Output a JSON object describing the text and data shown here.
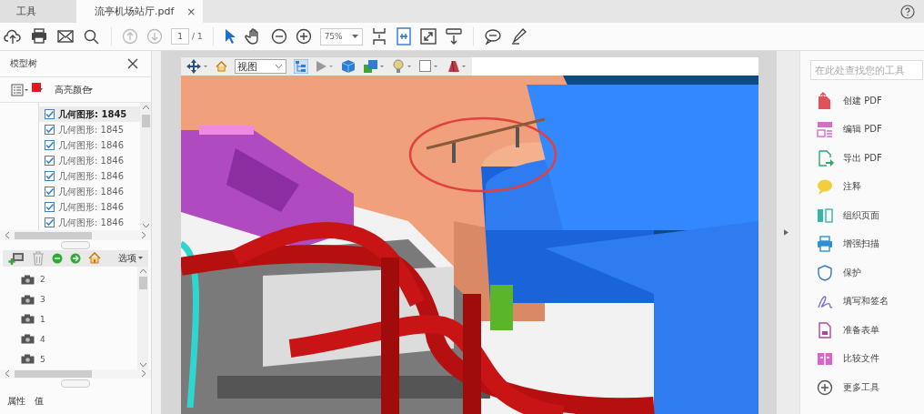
{
  "tabs": [
    {
      "label": "工具",
      "selected": false
    },
    {
      "label": "流亭机场站厅.pdf",
      "selected": true,
      "close": "×"
    }
  ],
  "toolbar": {
    "page_input": "1",
    "page_total": "/ 1",
    "zoom": "75%"
  },
  "model_tree": {
    "title": "模型树",
    "highlight_label": "高亮颜色",
    "items": [
      {
        "label": "几何图形: 1845",
        "checked": true,
        "selected": true
      },
      {
        "label": "几何图形: 1845",
        "checked": true,
        "selected": false
      },
      {
        "label": "几何图形: 1846",
        "checked": true,
        "selected": false
      },
      {
        "label": "几何图形: 1846",
        "checked": true,
        "selected": false
      },
      {
        "label": "几何图形: 1846",
        "checked": true,
        "selected": false
      },
      {
        "label": "几何图形: 1846",
        "checked": true,
        "selected": false
      },
      {
        "label": "几何图形: 1846",
        "checked": true,
        "selected": false
      },
      {
        "label": "几何图形: 1846",
        "checked": true,
        "selected": false
      }
    ]
  },
  "views": {
    "options": "选项",
    "items": [
      {
        "label": "2"
      },
      {
        "label": "3"
      },
      {
        "label": "1"
      },
      {
        "label": "4"
      },
      {
        "label": "5"
      }
    ]
  },
  "properties": {
    "columns": [
      "属性",
      "值"
    ]
  },
  "viewer_toolbar": {
    "view_select": "视图"
  },
  "tools_panel": {
    "search_placeholder": "在此处查找您的工具",
    "items": [
      {
        "label": "创建 PDF",
        "kind": "create",
        "color": "#e0525a"
      },
      {
        "label": "编辑 PDF",
        "kind": "edit",
        "color": "#d36fc6"
      },
      {
        "label": "导出 PDF",
        "kind": "export",
        "color": "#2fa86a"
      },
      {
        "label": "注释",
        "kind": "comment",
        "color": "#f2cd3c"
      },
      {
        "label": "组织页面",
        "kind": "organize",
        "color": "#35b5a5"
      },
      {
        "label": "增强扫描",
        "kind": "scan",
        "color": "#2f8fd6"
      },
      {
        "label": "保护",
        "kind": "protect",
        "color": "#3a74c4"
      },
      {
        "label": "填写和签名",
        "kind": "sign",
        "color": "#7c6fd0"
      },
      {
        "label": "准备表单",
        "kind": "form",
        "color": "#b0479a"
      },
      {
        "label": "比较文件",
        "kind": "compare",
        "color": "#d866c8"
      },
      {
        "label": "更多工具",
        "kind": "more",
        "color": "#555555"
      }
    ]
  }
}
